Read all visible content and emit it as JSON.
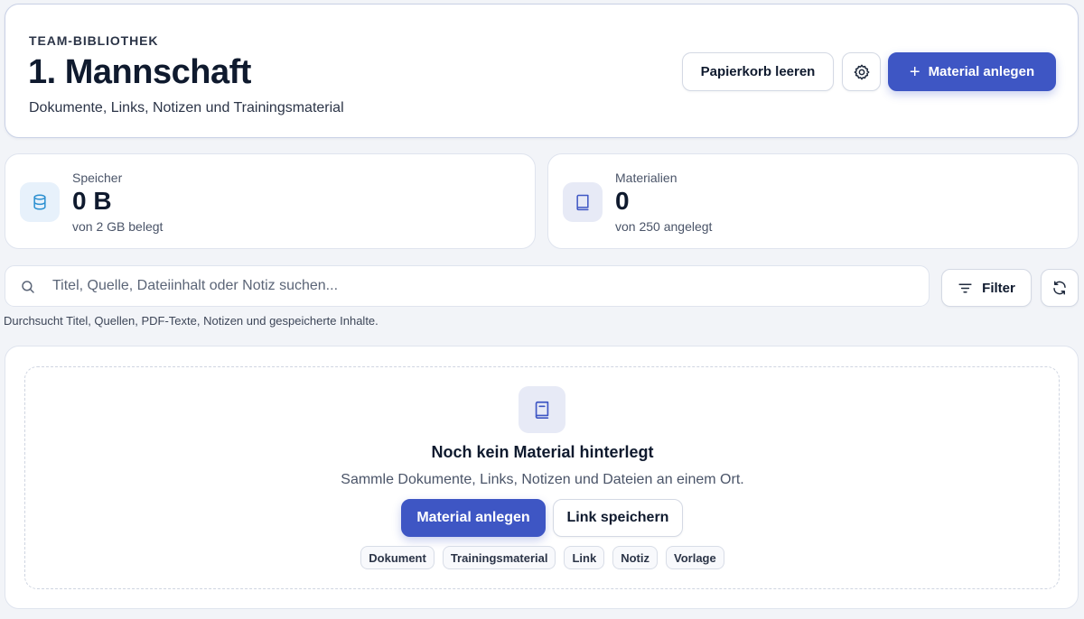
{
  "header": {
    "eyebrow": "TEAM-BIBLIOTHEK",
    "title": "1. Mannschaft",
    "subtitle": "Dokumente, Links, Notizen und Trainingsmaterial",
    "trash_label": "Papierkorb leeren",
    "settings_icon": "gear-icon",
    "add_label": "Material anlegen",
    "add_icon": "plus-icon"
  },
  "stats": {
    "storage": {
      "label": "Speicher",
      "value": "0 B",
      "sub": "von 2 GB belegt",
      "icon": "database-icon"
    },
    "materials": {
      "label": "Materialien",
      "value": "0",
      "sub": "von 250 angelegt",
      "icon": "book-icon"
    }
  },
  "search": {
    "placeholder": "Titel, Quelle, Dateiinhalt oder Notiz suchen...",
    "value": "",
    "hint": "Durchsucht Titel, Quellen, PDF-Texte, Notizen und gespeicherte Inhalte.",
    "filter_label": "Filter",
    "refresh_icon": "refresh-icon"
  },
  "empty_state": {
    "icon": "book-icon",
    "title": "Noch kein Material hinterlegt",
    "description": "Sammle Dokumente, Links, Notizen und Dateien an einem Ort.",
    "add_label": "Material anlegen",
    "link_label": "Link speichern",
    "types": [
      "Dokument",
      "Trainingsmaterial",
      "Link",
      "Notiz",
      "Vorlage"
    ]
  },
  "colors": {
    "primary": "#3e56c4",
    "background": "#f2f4f8",
    "storage_icon": "#2a8fd0",
    "book_icon": "#3e56c4"
  }
}
